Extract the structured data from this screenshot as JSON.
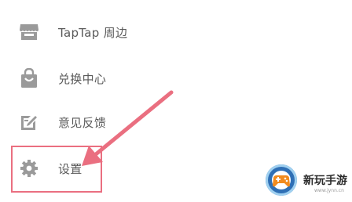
{
  "menu": {
    "items": [
      {
        "label": "TapTap 周边",
        "icon": "shop-icon"
      },
      {
        "label": "兑换中心",
        "icon": "bag-icon"
      },
      {
        "label": "意见反馈",
        "icon": "edit-feedback-icon"
      },
      {
        "label": "设置",
        "icon": "gear-icon"
      }
    ]
  },
  "annotation": {
    "color": "#ea6f80"
  },
  "watermark": {
    "text": "新玩手游",
    "url": "www.jynn.cn"
  },
  "colors": {
    "icon": "#9a9a9a",
    "label": "#5a5a5a",
    "background": "#ffffff"
  }
}
